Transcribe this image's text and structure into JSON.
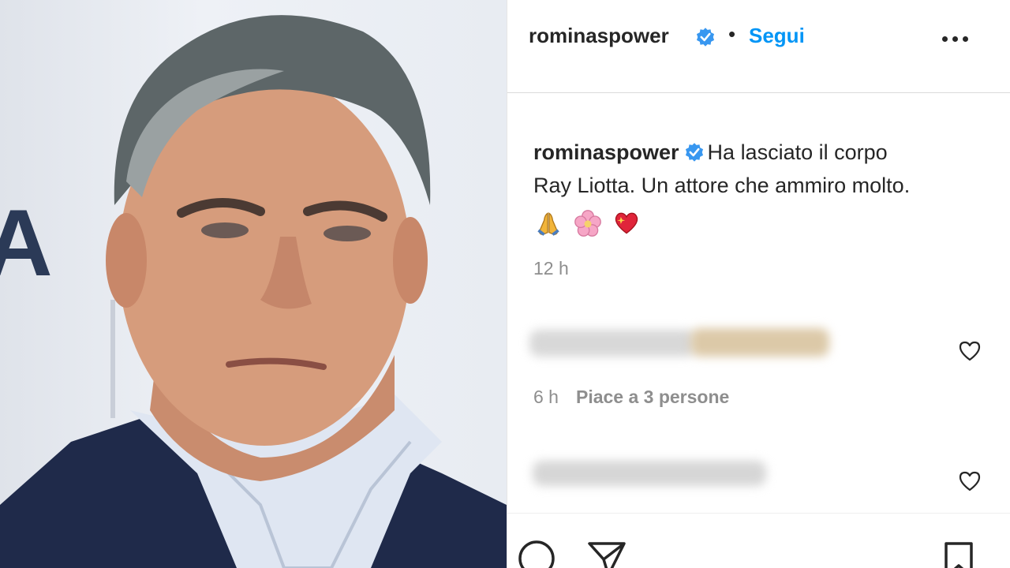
{
  "post": {
    "username": "rominaspower",
    "follow_label": "Segui",
    "separator": "•",
    "caption": {
      "username": "rominaspower",
      "text_line1": "Ha lasciato il corpo",
      "text_line2": "Ray Liotta. Un attore che ammiro molto.",
      "emojis": [
        "folded-hands",
        "cherry-blossom",
        "sparkling-heart"
      ]
    },
    "caption_time": "12 h",
    "comments": [
      {
        "time": "6 h",
        "likes": "Piace a 3 persone",
        "blurred": true
      },
      {
        "blurred": true
      }
    ]
  },
  "photo": {
    "backdrop_letter": "A"
  },
  "icons": {
    "verified": "verified-badge-icon",
    "more": "more-options-icon",
    "heart": "heart-icon",
    "comment": "comment-icon",
    "share": "share-icon",
    "save": "bookmark-icon"
  },
  "colors": {
    "link": "#0095f6",
    "verified": "#3897f0",
    "text": "#262626",
    "muted": "#8e8e8e"
  }
}
